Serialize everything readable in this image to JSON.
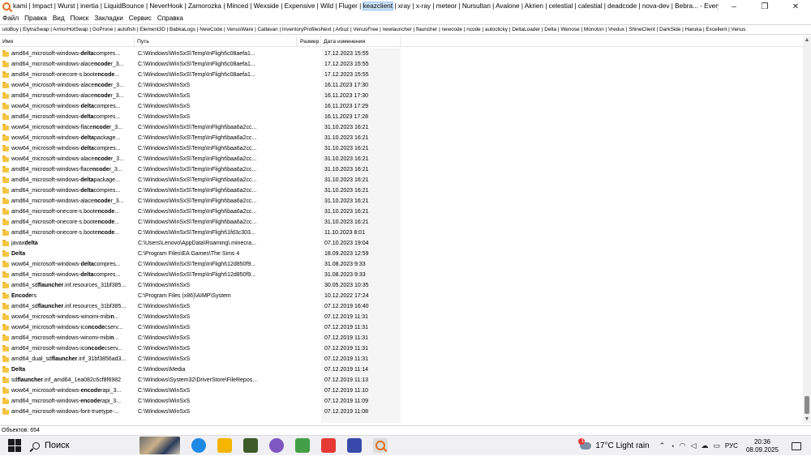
{
  "window": {
    "title_prefix": "kami | Impact | Wurst | inertia | LiquidBounce | NeverHook | Zamorozka | Minced | Wexside | Expensive | Wild | Fluger | ",
    "title_highlight": "keazclient",
    "title_suffix": " | xray | x-ray | meteor | Nursultan | Avalone | Akrien | celestial | calestial | deadcode | nova-dev | Bebra... - Everything",
    "minimize": "–",
    "maximize": "❐",
    "close": "✕"
  },
  "menu": [
    "Файл",
    "Правка",
    "Вид",
    "Поиск",
    "Закладки",
    "Сервис",
    "Справка"
  ],
  "filters": "utoBuy | ElytraSwap | ArmorHotSwap | GoProne | autofish | Element3D | BabkaLogs | NewCode | VenusWare | Catlavan | InventoryProfilesNext | Arbuz | VenusFree | newlauncher | flauncher | newcode | ncode | autoclicky | DeltaLoader | Delta | Wenose | Monoton | Vredux | ShineClient | DarkSide | Haruka | Excellent | Venus",
  "columns": {
    "name": "Имя",
    "path": "Путь",
    "size": "Размер",
    "date": "Дата изменения"
  },
  "rows": [
    {
      "pre": "amd64_microsoft-windows-",
      "b": "delta",
      "post": "compres...",
      "path": "C:\\Windows\\WinSxS\\Temp\\InFlight\\c08aefa1...",
      "date": "17.12.2023 15:55"
    },
    {
      "pre": "amd64_microsoft-windows-alace",
      "b": "ncode",
      "post": "r_3...",
      "path": "C:\\Windows\\WinSxS\\Temp\\InFlight\\c08aefa1...",
      "date": "17.12.2023 15:55"
    },
    {
      "pre": "amd64_microsoft-onecore-s.boote",
      "b": "ncode",
      "post": "...",
      "path": "C:\\Windows\\WinSxS\\Temp\\InFlight\\c08aefa1...",
      "date": "17.12.2023 15:55"
    },
    {
      "pre": "wow64_microsoft-windows-alace",
      "b": "ncode",
      "post": "r_3...",
      "path": "C:\\Windows\\WinSxS",
      "date": "16.11.2023 17:30"
    },
    {
      "pre": "amd64_microsoft-windows-alace",
      "b": "ncode",
      "post": "r_3...",
      "path": "C:\\Windows\\WinSxS",
      "date": "16.11.2023 17:30"
    },
    {
      "pre": "wow64_microsoft-windows-",
      "b": "delta",
      "post": "compres...",
      "path": "C:\\Windows\\WinSxS",
      "date": "16.11.2023 17:29"
    },
    {
      "pre": "amd64_microsoft-windows-",
      "b": "delta",
      "post": "compres...",
      "path": "C:\\Windows\\WinSxS",
      "date": "16.11.2023 17:28"
    },
    {
      "pre": "wow64_microsoft-windows-flace",
      "b": "ncode",
      "post": "r_3...",
      "path": "C:\\Windows\\WinSxS\\Temp\\InFlight\\baa6a2cc...",
      "date": "31.10.2023 16:21"
    },
    {
      "pre": "wow64_microsoft-windows-",
      "b": "delta",
      "post": "package...",
      "path": "C:\\Windows\\WinSxS\\Temp\\InFlight\\baa6a2cc...",
      "date": "31.10.2023 16:21"
    },
    {
      "pre": "wow64_microsoft-windows-",
      "b": "delta",
      "post": "compres...",
      "path": "C:\\Windows\\WinSxS\\Temp\\InFlight\\baa6a2cc...",
      "date": "31.10.2023 16:21"
    },
    {
      "pre": "wow64_microsoft-windows-alace",
      "b": "ncode",
      "post": "r_3...",
      "path": "C:\\Windows\\WinSxS\\Temp\\InFlight\\baa6a2cc...",
      "date": "31.10.2023 16:21"
    },
    {
      "pre": "amd64_microsoft-windows-flace",
      "b": "ncode",
      "post": "r_3...",
      "path": "C:\\Windows\\WinSxS\\Temp\\InFlight\\baa6a2cc...",
      "date": "31.10.2023 16:21"
    },
    {
      "pre": "amd64_microsoft-windows-",
      "b": "delta",
      "post": "package...",
      "path": "C:\\Windows\\WinSxS\\Temp\\InFlight\\baa6a2cc...",
      "date": "31.10.2023 16:21"
    },
    {
      "pre": "amd64_microsoft-windows-",
      "b": "delta",
      "post": "compres...",
      "path": "C:\\Windows\\WinSxS\\Temp\\InFlight\\baa6a2cc...",
      "date": "31.10.2023 16:21"
    },
    {
      "pre": "amd64_microsoft-windows-alace",
      "b": "ncode",
      "post": "r_3...",
      "path": "C:\\Windows\\WinSxS\\Temp\\InFlight\\baa6a2cc...",
      "date": "31.10.2023 16:21"
    },
    {
      "pre": "amd64_microsoft-onecore-s.boote",
      "b": "ncode",
      "post": "...",
      "path": "C:\\Windows\\WinSxS\\Temp\\InFlight\\baa6a2cc...",
      "date": "31.10.2023 16:21"
    },
    {
      "pre": "amd64_microsoft-onecore-s.boote",
      "b": "ncode",
      "post": "...",
      "path": "C:\\Windows\\WinSxS\\Temp\\InFlight\\baa6a2cc...",
      "date": "31.10.2023 16:21"
    },
    {
      "pre": "amd64_microsoft-onecore-s.boote",
      "b": "ncode",
      "post": "...",
      "path": "C:\\Windows\\WinSxS\\Temp\\InFlight\\1fd3c303...",
      "date": "11.10.2023 8:01"
    },
    {
      "pre": "javax",
      "b": "delta",
      "post": "",
      "path": "C:\\Users\\Lenovo\\AppData\\Roaming\\.minecra...",
      "date": "07.10.2023 19:04"
    },
    {
      "pre": "",
      "b": "Delta",
      "post": "",
      "path": "C:\\Program Files\\EA Games\\The Sims 4",
      "date": "18.09.2023 12:59"
    },
    {
      "pre": "wow64_microsoft-windows-",
      "b": "delta",
      "post": "compres...",
      "path": "C:\\Windows\\WinSxS\\Temp\\InFlight\\12d850f9...",
      "date": "31.08.2023 9:33"
    },
    {
      "pre": "amd64_microsoft-windows-",
      "b": "delta",
      "post": "compres...",
      "path": "C:\\Windows\\WinSxS\\Temp\\InFlight\\12d850f9...",
      "date": "31.08.2023 9:33"
    },
    {
      "pre": "amd64_sd",
      "b": "flauncher",
      "post": ".inf.resources_31bf385...",
      "path": "C:\\Windows\\WinSxS",
      "date": "30.05.2023 10:35"
    },
    {
      "pre": "",
      "b": "Encode",
      "post": "rs",
      "path": "C:\\Program Files (x86)\\AIMP\\System",
      "date": "10.12.2022 17:24"
    },
    {
      "pre": "amd64_sd",
      "b": "flauncher",
      "post": ".inf.resources_31bf385...",
      "path": "C:\\Windows\\WinSxS",
      "date": "07.12.2019 16:40"
    },
    {
      "pre": "wow64_microsoft-windows-winomi-mibi",
      "b": "n",
      "post": "...",
      "path": "C:\\Windows\\WinSxS",
      "date": "07.12.2019 11:31"
    },
    {
      "pre": "wow64_microsoft-windows-ico",
      "b": "ncode",
      "post": "cserv...",
      "path": "C:\\Windows\\WinSxS",
      "date": "07.12.2019 11:31"
    },
    {
      "pre": "amd64_microsoft-windows-winomi-mibi",
      "b": "n",
      "post": "...",
      "path": "C:\\Windows\\WinSxS",
      "date": "07.12.2019 11:31"
    },
    {
      "pre": "amd64_microsoft-windows-ico",
      "b": "ncode",
      "post": "cserv...",
      "path": "C:\\Windows\\WinSxS",
      "date": "07.12.2019 11:31"
    },
    {
      "pre": "amd64_dual_sd",
      "b": "flauncher",
      "post": ".inf_31bf3856ad3...",
      "path": "C:\\Windows\\WinSxS",
      "date": "07.12.2019 11:31"
    },
    {
      "pre": "",
      "b": "Delta",
      "post": "",
      "path": "C:\\Windows\\Media",
      "date": "07.12.2019 11:14"
    },
    {
      "pre": "sd",
      "b": "flauncher",
      "post": ".inf_amd64_1ea082c6cf8f6982",
      "path": "C:\\Windows\\System32\\DriverStore\\FileRepos...",
      "date": "07.12.2019 11:13"
    },
    {
      "pre": "wow64_microsoft-windows-",
      "b": "encode",
      "post": "rapi_3...",
      "path": "C:\\Windows\\WinSxS",
      "date": "07.12.2019 11:10"
    },
    {
      "pre": "amd64_microsoft-windows-",
      "b": "encode",
      "post": "rapi_3...",
      "path": "C:\\Windows\\WinSxS",
      "date": "07.12.2019 11:09"
    },
    {
      "pre": "amd64_microsoft-windows-font-truetype-...",
      "b": "",
      "post": "",
      "path": "C:\\Windows\\WinSxS",
      "date": "07.12.2019 11:08"
    }
  ],
  "status": "Объектов: 654",
  "taskbar": {
    "search_label": "Поиск",
    "weather": "17°C Light rain",
    "lang": "РУС",
    "time": "20:36",
    "date": "08.09.2025",
    "weather_badge": "1"
  }
}
